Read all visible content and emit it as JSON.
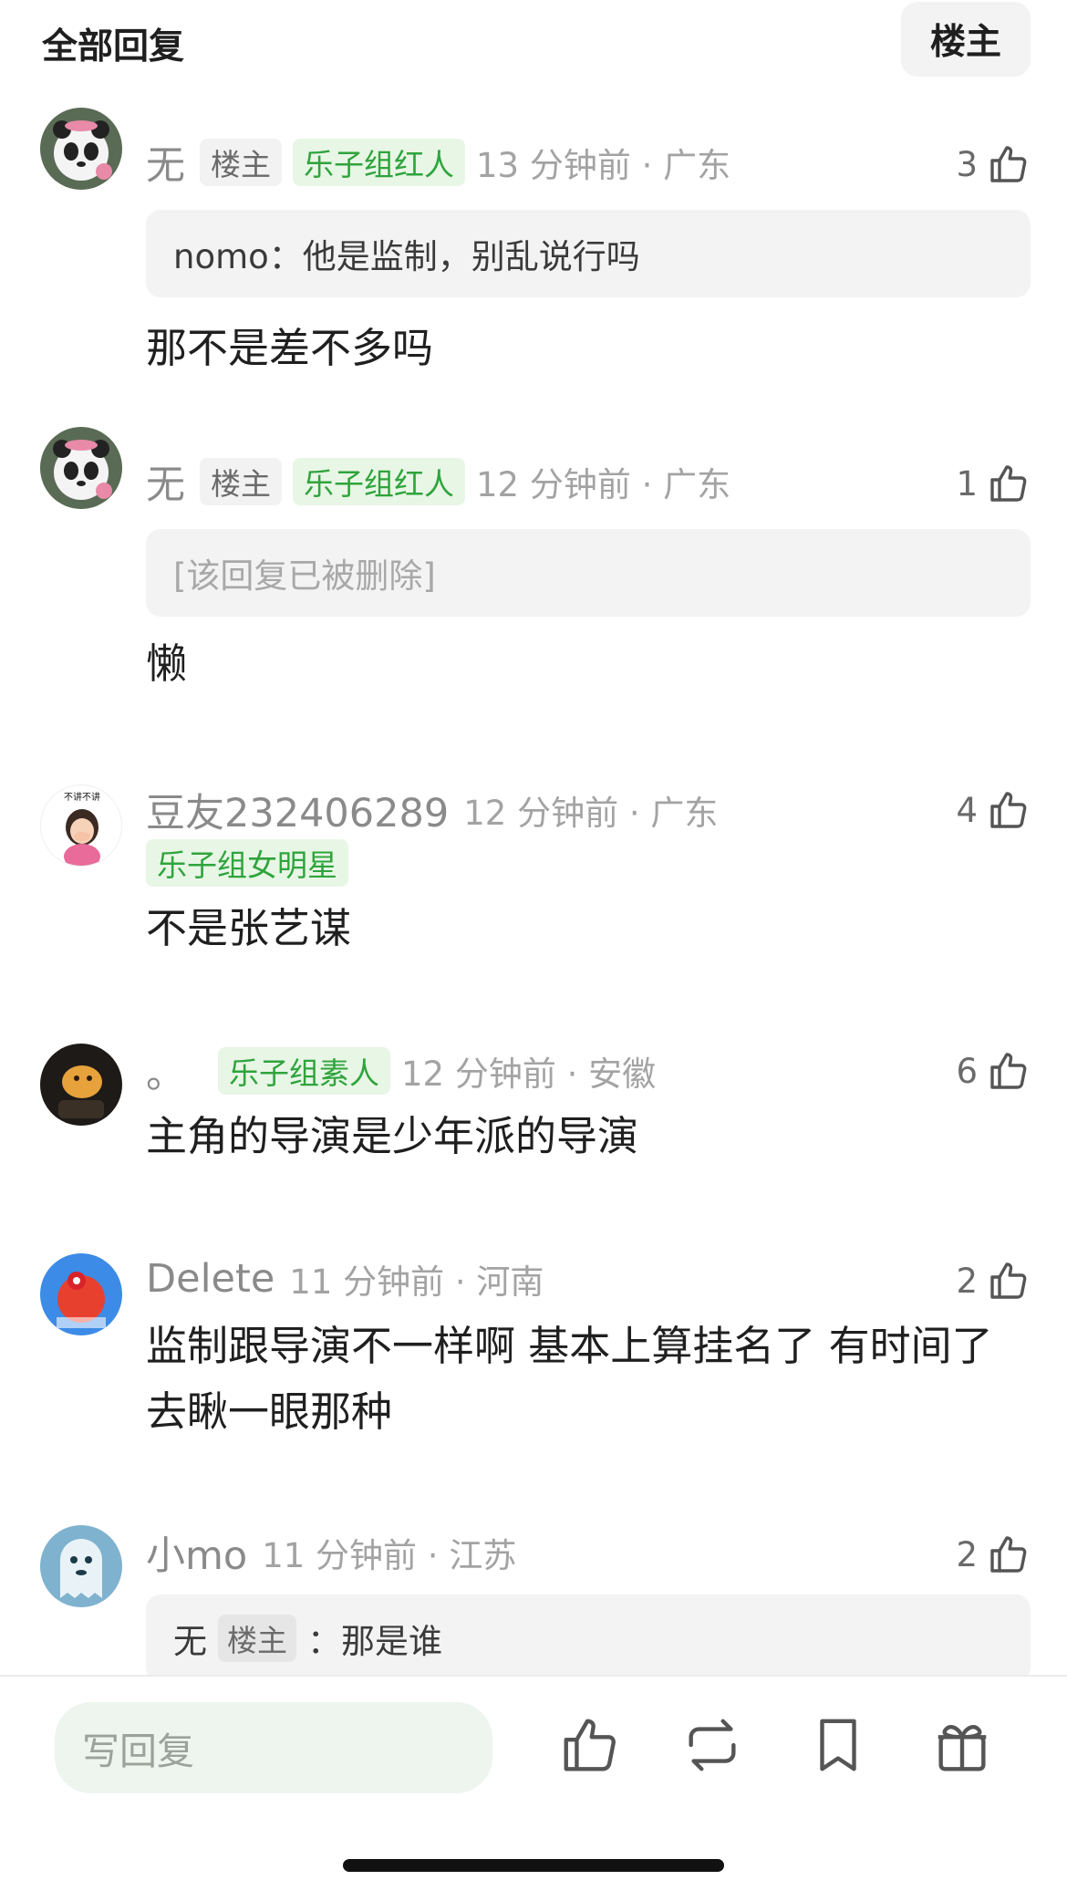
{
  "header": {
    "title": "全部回复",
    "op_filter_label": "楼主"
  },
  "comments": [
    {
      "name": "无",
      "op_badge": "楼主",
      "tag": "乐子组红人",
      "time": "13 分钟前 · 广东",
      "likes": "3",
      "quote": "nomo：他是监制，别乱说行吗",
      "text": "那不是差不多吗",
      "avatar_icon": "panda-avatar"
    },
    {
      "name": "无",
      "op_badge": "楼主",
      "tag": "乐子组红人",
      "time": "12 分钟前 · 广东",
      "likes": "1",
      "quote": "[该回复已被删除]",
      "text": "懒",
      "avatar_icon": "panda-avatar"
    },
    {
      "name": "豆友232406289",
      "tag": "乐子组女明星",
      "time": "12 分钟前 · 广东",
      "likes": "4",
      "text": "不是张艺谋",
      "avatar_icon": "cartoon-girl-avatar",
      "avatar_caption": "不讲不讲"
    },
    {
      "name": "。",
      "tag": "乐子组素人",
      "time": "12 分钟前 · 安徽",
      "likes": "6",
      "text": "主角的导演是少年派的导演",
      "avatar_icon": "dark-cartoon-avatar"
    },
    {
      "name": "Delete",
      "time": "11 分钟前 · 河南",
      "likes": "2",
      "text": "监制跟导演不一样啊  基本上算挂名了  有时间了去瞅一眼那种",
      "avatar_icon": "blue-red-avatar"
    },
    {
      "name": "小mo",
      "time": "11 分钟前 · 江苏",
      "likes": "2",
      "quote_name": "无",
      "quote_op_badge": "楼主",
      "quote_text": "：那是谁",
      "avatar_icon": "blue-ghost-avatar"
    }
  ],
  "bottom_bar": {
    "reply_placeholder": "写回复",
    "icons": [
      "thumbs-up-icon",
      "repost-icon",
      "bookmark-icon",
      "gift-icon"
    ]
  },
  "colors": {
    "green_tag_text": "#2fa43c",
    "green_tag_bg": "#e8f6e6",
    "reply_input_bg": "#edf5ee"
  }
}
